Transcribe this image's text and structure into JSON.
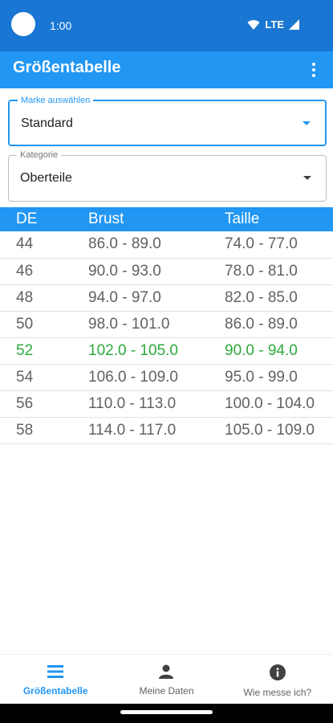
{
  "status_bar": {
    "time": "1:00",
    "network": "LTE",
    "icons": [
      "wifi-icon",
      "signal-icon"
    ]
  },
  "app_bar": {
    "title": "Größentabelle",
    "menu_icon": "more-vert-icon"
  },
  "brand_select": {
    "label": "Marke auswählen",
    "value": "Standard"
  },
  "category_select": {
    "label": "Kategorie",
    "value": "Oberteile"
  },
  "table": {
    "headers": [
      "DE",
      "Brust",
      "Taille"
    ],
    "rows": [
      [
        "44",
        "86.0 - 89.0",
        "74.0 - 77.0"
      ],
      [
        "46",
        "90.0 - 93.0",
        "78.0 - 81.0"
      ],
      [
        "48",
        "94.0 - 97.0",
        "82.0 - 85.0"
      ],
      [
        "50",
        "98.0 - 101.0",
        "86.0 - 89.0"
      ],
      [
        "52",
        "102.0 - 105.0",
        "90.0 - 94.0"
      ],
      [
        "54",
        "106.0 - 109.0",
        "95.0 - 99.0"
      ],
      [
        "56",
        "110.0 - 113.0",
        "100.0 - 104.0"
      ],
      [
        "58",
        "114.0 - 117.0",
        "105.0 - 109.0"
      ]
    ],
    "highlighted_row": 4
  },
  "bottom_nav": {
    "items": [
      {
        "label": "Größentabelle",
        "icon": "list-icon",
        "active": true
      },
      {
        "label": "Meine Daten",
        "icon": "person-icon",
        "active": false
      },
      {
        "label": "Wie messe ich?",
        "icon": "info-icon",
        "active": false
      }
    ]
  },
  "colors": {
    "primary": "#2196f3",
    "status_bar": "#1976d2",
    "highlight": "#2eaa3c",
    "text": "#616161"
  }
}
